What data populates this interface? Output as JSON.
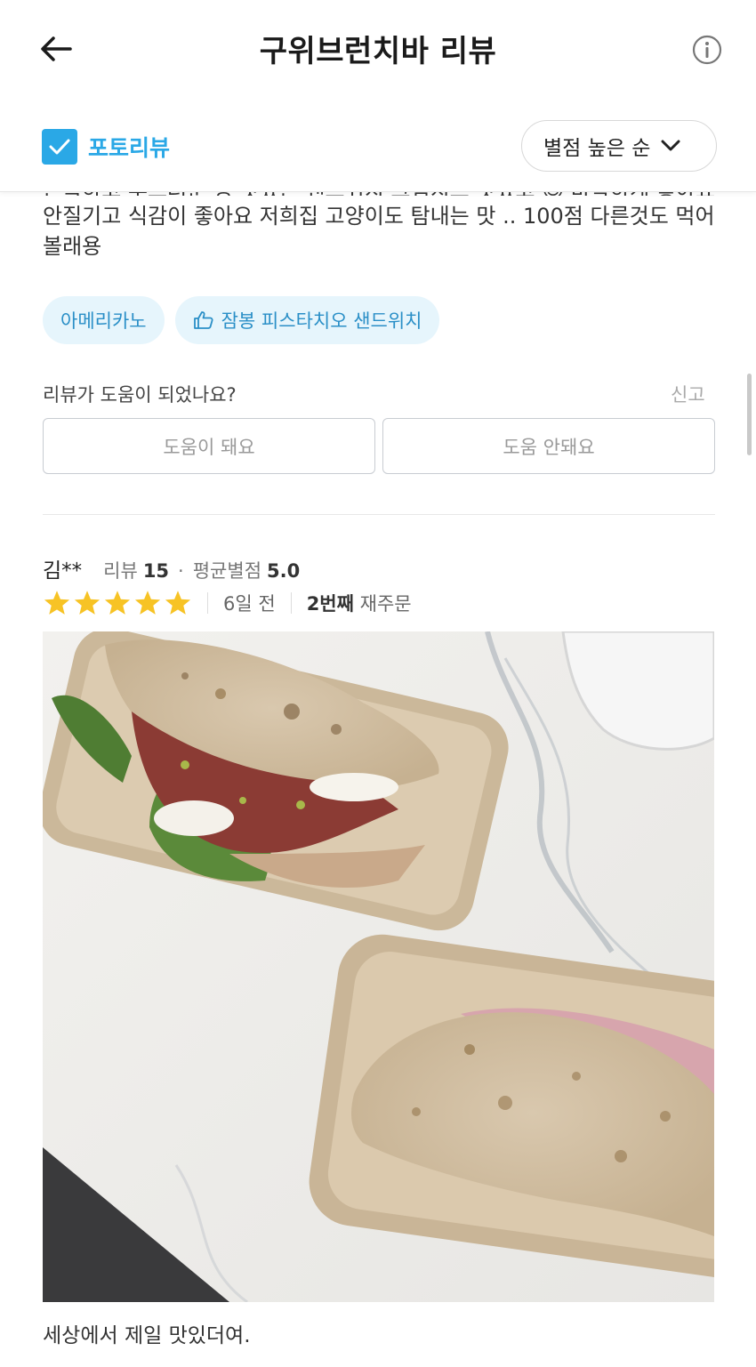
{
  "header": {
    "title": "구위브런치바 리뷰",
    "back_icon": "arrow-left-icon",
    "info_icon": "info-icon"
  },
  "filter": {
    "photo_review_label": "포토리뷰",
    "photo_review_checked": true,
    "sort_label": "별점 높은 순",
    "accent_color": "#2aa8e6"
  },
  "prev_review": {
    "cut_text": "쫀득하고 부드러운 빵 맛있는 샌드위치 크림치즈 맛있고 😊 바삭하게 좋아요",
    "text": "안질기고 식감이 좋아요 저희집 고양이도 탐내는 맛 .. 100점 다른것도 먹어볼래용",
    "tags": [
      {
        "label": "아메리카노",
        "liked": false
      },
      {
        "label": "잠봉 피스타치오 샌드위치",
        "liked": true
      }
    ],
    "helpful_question": "리뷰가 도움이 되었나요?",
    "report_label": "신고",
    "helpful_yes": "도움이 돼요",
    "helpful_no": "도움 안돼요"
  },
  "review": {
    "name": "김**",
    "review_label": "리뷰",
    "review_count": "15",
    "avg_label": "평균별점",
    "avg_rating": "5.0",
    "rating": 5,
    "date": "6일 전",
    "reorder_count": "2번째",
    "reorder_label": "재주문",
    "photo_description_icon": "food-photo",
    "comment": "세상에서 제일 맛있더여."
  },
  "colors": {
    "star": "#f7c325",
    "tag_bg": "#e6f5fc",
    "tag_text": "#2a8fc7"
  }
}
